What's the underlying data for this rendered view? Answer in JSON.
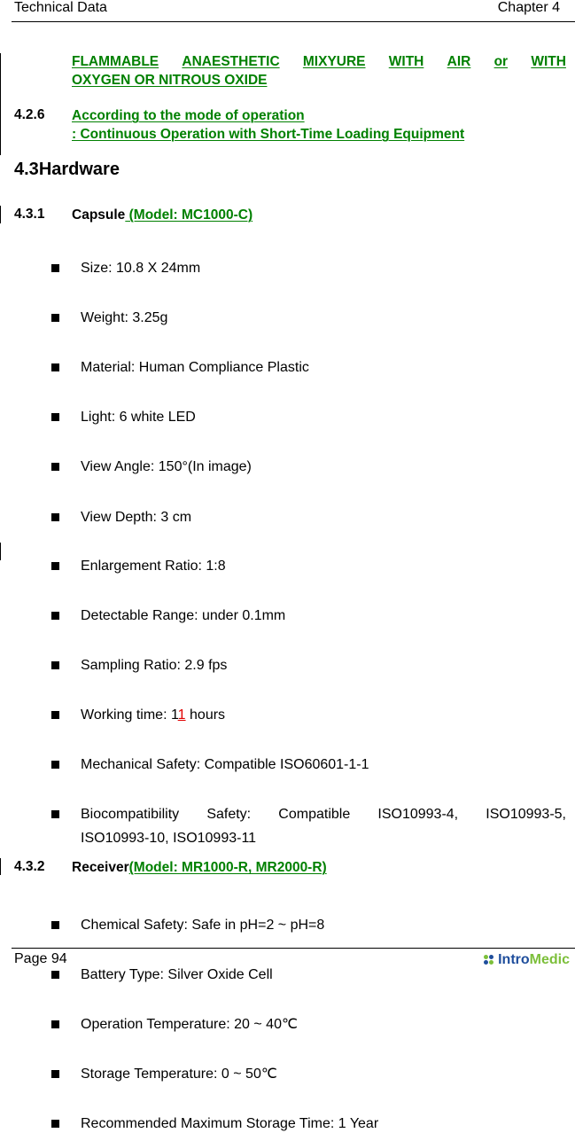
{
  "header": {
    "left": "Technical Data",
    "right": "Chapter 4"
  },
  "warning": {
    "line1_words": [
      "FLAMMABLE",
      "ANAESTHETIC",
      "MIXYURE",
      "WITH",
      "AIR",
      "or",
      "WITH"
    ],
    "line2": "OXYGEN OR NITROUS OXIDE"
  },
  "section_4_2_6": {
    "number": "4.2.6",
    "title_line1": "According to the mode of operation",
    "title_line2": ": Continuous Operation with Short-Time Loading Equipment"
  },
  "section_4_3": {
    "number": "4.3",
    "title": "Hardware"
  },
  "section_4_3_1": {
    "number": "4.3.1",
    "title": "Capsule",
    "model": " (Model: MC1000-C)",
    "specs": [
      {
        "text": "Size: 10.8 X 24mm"
      },
      {
        "text": "Weight: 3.25g"
      },
      {
        "text": "Material: Human Compliance Plastic"
      },
      {
        "text": "Light: 6 white LED"
      },
      {
        "text": "View Angle: 150°(In image)"
      },
      {
        "text": "View Depth: 3 cm"
      },
      {
        "text": "Enlargement Ratio: 1:8"
      },
      {
        "text": "Detectable Range: under 0.1mm"
      },
      {
        "text": "Sampling Ratio: 2.9 fps"
      },
      {
        "prefix": "Working time: 1",
        "highlight": "1",
        "suffix": " hours",
        "highlight_color": "#e00000"
      },
      {
        "text": "Mechanical Safety: Compatible ISO60601-1-1"
      },
      {
        "line1": "Biocompatibility Safety: Compatible ISO10993-4, ISO10993-5,",
        "line2": "ISO10993-10, ISO10993-11"
      },
      {
        "text": "Chemical Safety: Safe in pH=2 ~ pH=8"
      },
      {
        "text": "Battery Type: Silver Oxide Cell"
      },
      {
        "text": "Operation Temperature: 20 ~ 40℃"
      },
      {
        "text": "Storage Temperature: 0 ~ 50℃"
      },
      {
        "text": "Recommended Maximum Storage Time: 1 Year"
      }
    ]
  },
  "section_4_3_2": {
    "number": "4.3.2",
    "title": "Receiver",
    "model": "(Model: MR1000-R, MR2000-R)"
  },
  "footer": {
    "page": "Page 94",
    "logo_part1": "Intro",
    "logo_part2": "Medic",
    "logo_icon": "intromedic-logo-icon"
  },
  "colors": {
    "link_green": "#008000",
    "highlight_red": "#e00000",
    "logo_blue": "#1f4e9c",
    "logo_green": "#7cbf3a"
  }
}
